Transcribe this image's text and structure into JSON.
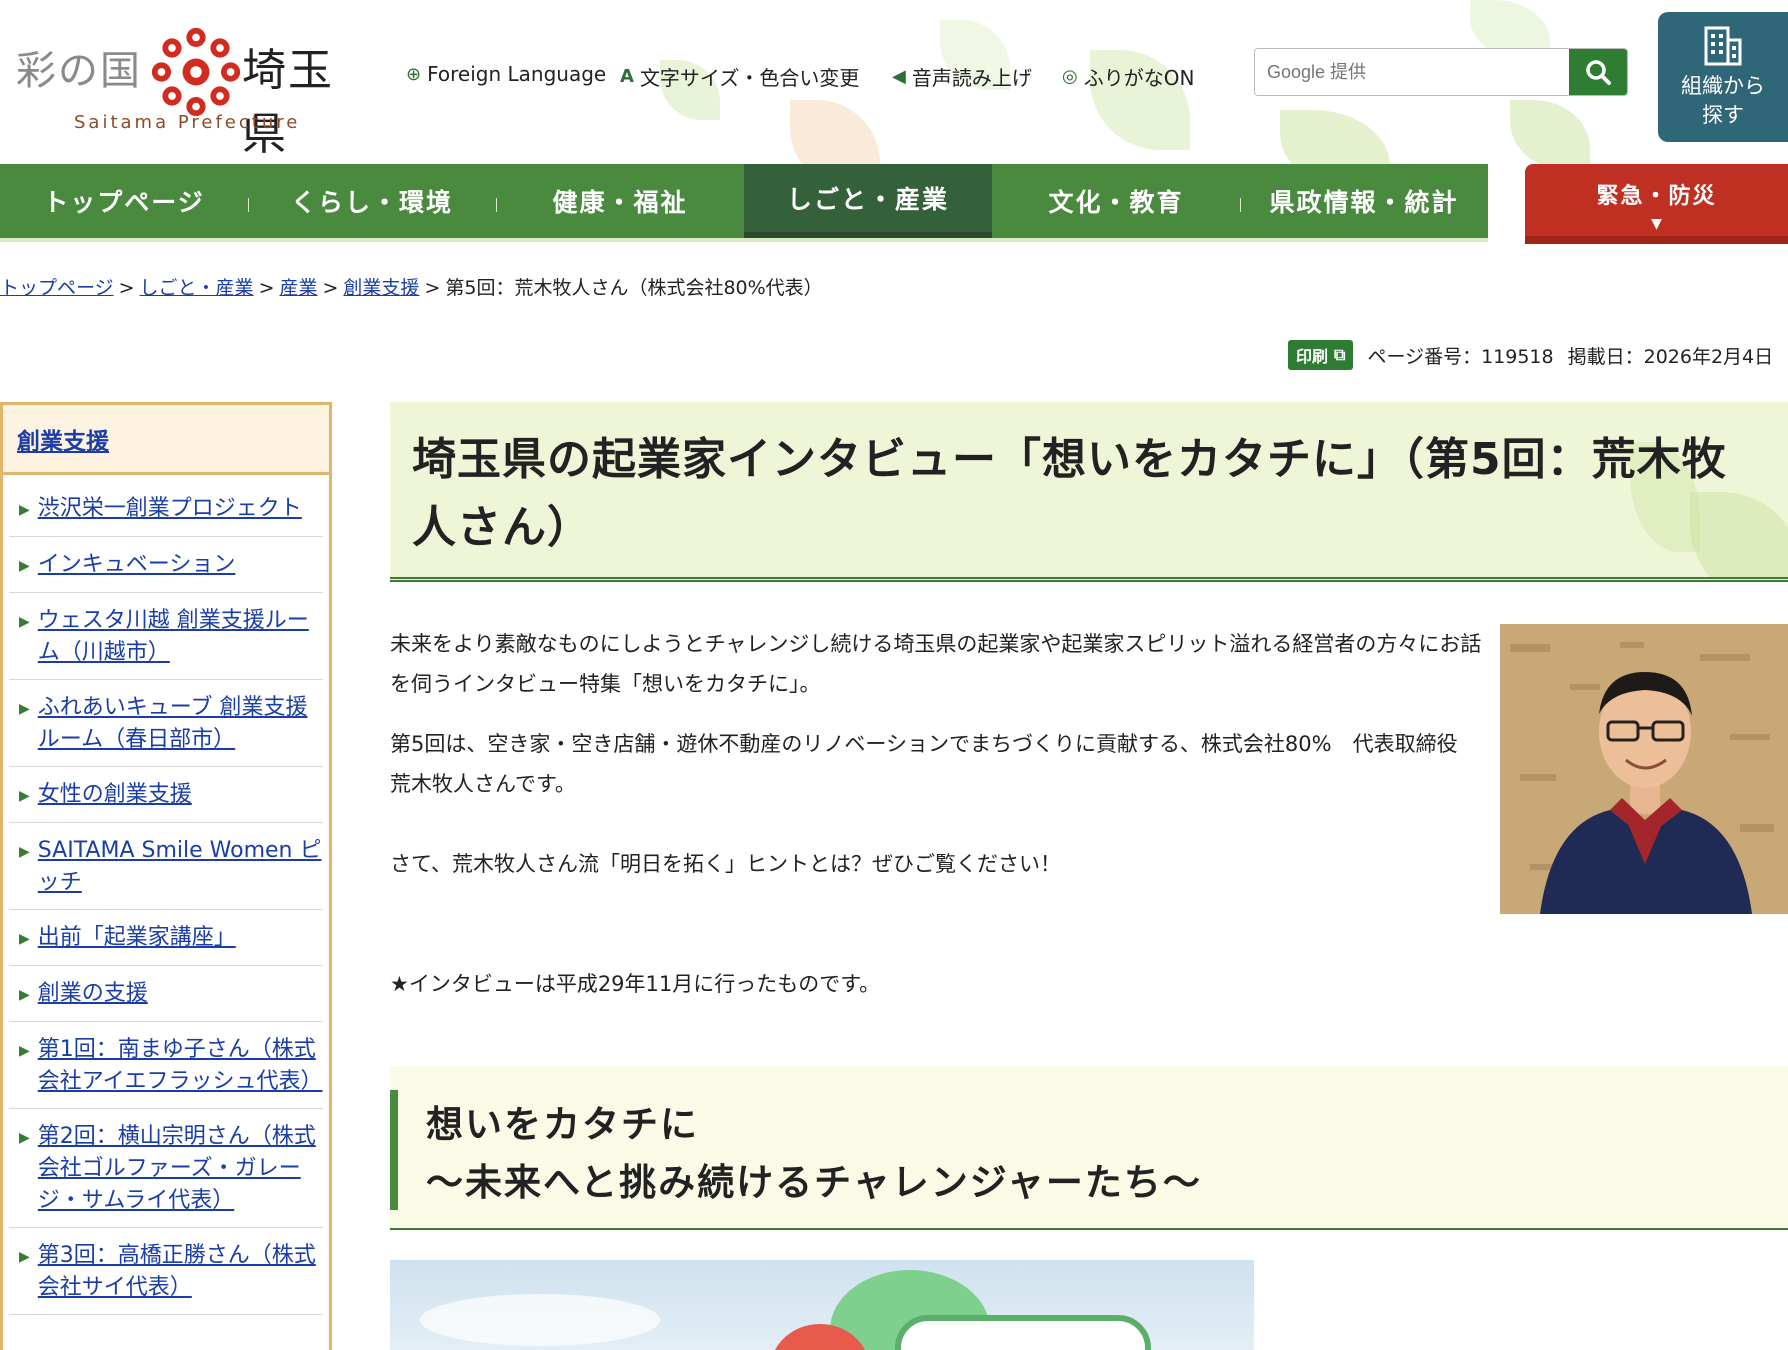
{
  "header": {
    "logo_left": "彩の国",
    "logo_right": "埼玉県",
    "logo_sub": "Saitama Prefecture",
    "utility_links": [
      {
        "label": "Foreign Language",
        "icon": "globe-icon"
      },
      {
        "label": "文字サイズ・色合い変更",
        "icon": "text-size-icon"
      },
      {
        "label": "音声読み上げ",
        "icon": "speaker-icon"
      },
      {
        "label": "ふりがなON",
        "icon": "furigana-icon"
      }
    ],
    "search": {
      "placeholder": "Google 提供",
      "button_icon": "search-icon"
    },
    "org_button": {
      "line1": "組織から",
      "line2": "探す",
      "icon": "building-icon"
    },
    "emergency": {
      "label": "緊急・防災",
      "icon": "chevron-down-icon"
    }
  },
  "nav": {
    "items": [
      {
        "label": "トップページ"
      },
      {
        "label": "くらし・環境"
      },
      {
        "label": "健康・福祉"
      },
      {
        "label": "しごと・産業"
      },
      {
        "label": "文化・教育"
      },
      {
        "label": "県政情報・統計"
      }
    ],
    "active_index": 3
  },
  "breadcrumb": {
    "links": [
      "トップページ",
      "しごと・産業",
      "産業",
      "創業支援"
    ],
    "separator": ">",
    "current": "第5回：荒木牧人さん（株式会社80%代表）"
  },
  "meta": {
    "print_label": "印刷",
    "page_number": "ページ番号：119518",
    "posted_date": "掲載日：2026年2月4日"
  },
  "sidebar": {
    "heading": "創業支援",
    "items": [
      {
        "label": "渋沢栄一創業プロジェクト"
      },
      {
        "label": "インキュベーション"
      },
      {
        "label": "ウェスタ川越 創業支援ルーム（川越市）"
      },
      {
        "label": "ふれあいキューブ 創業支援ルーム（春日部市）"
      },
      {
        "label": "女性の創業支援"
      },
      {
        "label": "SAITAMA Smile Women ピッチ"
      },
      {
        "label": "出前「起業家講座」"
      },
      {
        "label": "創業の支援"
      },
      {
        "label": "第1回：南まゆ子さん（株式会社アイエフラッシュ代表）"
      },
      {
        "label": "第2回：横山宗明さん（株式会社ゴルファーズ・ガレージ・サムライ代表）"
      },
      {
        "label": "第3回：高橋正勝さん（株式会社サイ代表）"
      }
    ]
  },
  "main": {
    "title": "埼玉県の起業家インタビュー「想いをカタチに」（第5回：荒木牧人さん）",
    "intro1": "未来をより素敵なものにしようとチャレンジし続ける埼玉県の起業家や起業家スピリット溢れる経営者の方々にお話を伺うインタビュー特集「想いをカタチに」。",
    "intro2": "第5回は、空き家・空き店舗・遊休不動産のリノベーションでまちづくりに貢献する、株式会社80%　代表取締役　荒木牧人さんです。",
    "intro3": "さて、荒木牧人さん流「明日を拓く」ヒントとは？ぜひご覧ください！",
    "note": "★インタビューは平成29年11月に行ったものです。",
    "section_line1": "想いをカタチに",
    "section_line2": "～未来へと挑み続けるチャレンジャーたち～"
  },
  "colors": {
    "nav_green": "#4a8a3f",
    "nav_active": "#35613a",
    "emergency_red": "#bf2f22",
    "org_teal": "#2f6779",
    "sidebar_border": "#e2b56c",
    "link_blue": "#1a3da8"
  }
}
